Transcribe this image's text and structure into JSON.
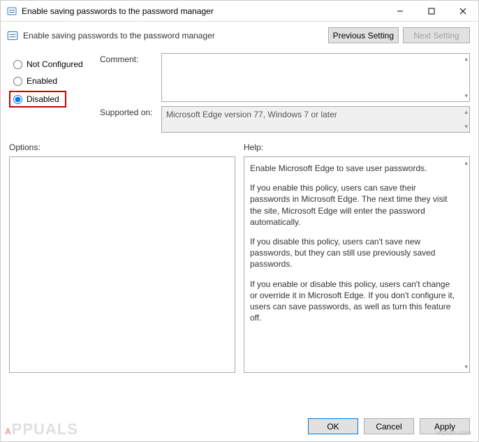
{
  "titlebar": {
    "title": "Enable saving passwords to the password manager"
  },
  "subheader": {
    "title": "Enable saving passwords to the password manager",
    "prev_setting": "Previous Setting",
    "next_setting": "Next Setting"
  },
  "radios": {
    "not_configured": "Not Configured",
    "enabled": "Enabled",
    "disabled": "Disabled",
    "selected": "disabled"
  },
  "fields": {
    "comment_label": "Comment:",
    "comment_value": "",
    "supported_label": "Supported on:",
    "supported_value": "Microsoft Edge version 77, Windows 7 or later"
  },
  "lower": {
    "options_label": "Options:",
    "help_label": "Help:"
  },
  "help": {
    "p1": "Enable Microsoft Edge to save user passwords.",
    "p2": "If you enable this policy, users can save their passwords in Microsoft Edge. The next time they visit the site, Microsoft Edge will enter the password automatically.",
    "p3": "If you disable this policy, users can't save new passwords, but they can still use previously saved passwords.",
    "p4": "If you enable or disable this policy, users can't change or override it in Microsoft Edge. If you don't configure it, users can save passwords, as well as turn this feature off."
  },
  "footer": {
    "ok": "OK",
    "cancel": "Cancel",
    "apply": "Apply"
  },
  "watermark": {
    "site": "wsxdn.com",
    "logo": "APPUALS"
  }
}
